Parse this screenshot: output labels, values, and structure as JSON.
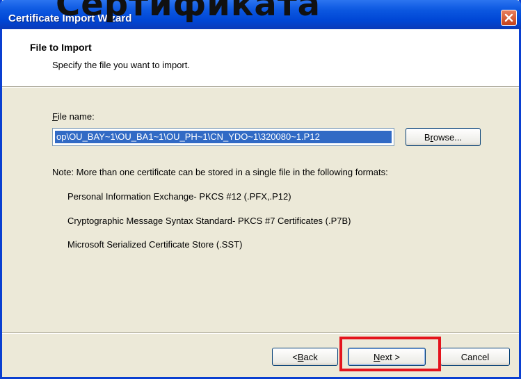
{
  "titlebar": {
    "title": "Certificate Import Wizard",
    "overlay_text": "Сертификата",
    "close_icon": "close-x-icon"
  },
  "header": {
    "title": "File to Import",
    "subtitle": "Specify the file you want to import."
  },
  "file": {
    "label_hotkey": "F",
    "label_rest": "ile name:",
    "value": "op\\OU_BAY~1\\OU_BA1~1\\OU_PH~1\\CN_YDO~1\\320080~1.P12",
    "browse_hotkey": "r",
    "browse_pre": "B",
    "browse_post": "owse..."
  },
  "note": "Note:  More than one certificate can be stored in a single file in the following formats:",
  "formats": [
    "Personal Information Exchange- PKCS #12 (.PFX,.P12)",
    "Cryptographic Message Syntax Standard- PKCS #7 Certificates (.P7B)",
    "Microsoft Serialized Certificate Store (.SST)"
  ],
  "buttons": {
    "back_pre": "< ",
    "back_hotkey": "B",
    "back_post": "ack",
    "next_hotkey": "N",
    "next_post": "ext >",
    "cancel": "Cancel"
  },
  "colors": {
    "titlebar": "#0054e3",
    "highlight": "#e4141c",
    "selection": "#316ac5"
  }
}
